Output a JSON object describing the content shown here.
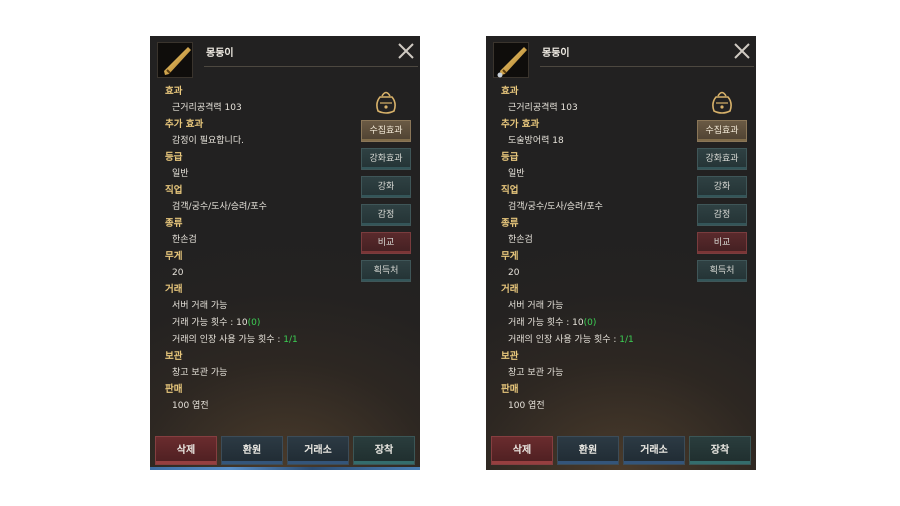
{
  "panels": [
    {
      "item_name": "몽둥이",
      "item_icon": "club-weapon-icon",
      "sections": [
        {
          "header": "효과",
          "rows": [
            {
              "text": "근거리공격력 103"
            }
          ]
        },
        {
          "header": "추가 효과",
          "rows": [
            {
              "text": "감정이 필요합니다."
            }
          ]
        },
        {
          "header": "등급",
          "rows": [
            {
              "text": "일반"
            }
          ]
        },
        {
          "header": "직업",
          "rows": [
            {
              "text": "검객/궁수/도사/승려/포수"
            }
          ]
        },
        {
          "header": "종류",
          "rows": [
            {
              "text": "한손검"
            }
          ]
        },
        {
          "header": "무게",
          "rows": [
            {
              "text": "20"
            }
          ]
        },
        {
          "header": "거래",
          "rows": [
            {
              "text": "서버 거래 가능"
            },
            {
              "text": "거래 가능 횟수 : 10",
              "extra": "(0)"
            },
            {
              "text": "거래의 인장 사용 가능 횟수 : ",
              "extra": "1/1"
            }
          ]
        },
        {
          "header": "보관",
          "rows": [
            {
              "text": "창고 보관 가능"
            }
          ]
        },
        {
          "header": "판매",
          "rows": [
            {
              "text": "100 엽전"
            }
          ]
        }
      ],
      "side_buttons": [
        "수집효과",
        "강화효과",
        "강화",
        "감정",
        "비교",
        "획득처"
      ],
      "bottom_buttons": [
        "삭제",
        "환원",
        "거래소",
        "장착"
      ]
    },
    {
      "item_name": "몽둥이",
      "item_icon": "club-weapon-icon",
      "sections": [
        {
          "header": "효과",
          "rows": [
            {
              "text": "근거리공격력 103"
            }
          ]
        },
        {
          "header": "추가 효과",
          "rows": [
            {
              "text": "도술방어력 18"
            }
          ]
        },
        {
          "header": "등급",
          "rows": [
            {
              "text": "일반"
            }
          ]
        },
        {
          "header": "직업",
          "rows": [
            {
              "text": "검객/궁수/도사/승려/포수"
            }
          ]
        },
        {
          "header": "종류",
          "rows": [
            {
              "text": "한손검"
            }
          ]
        },
        {
          "header": "무게",
          "rows": [
            {
              "text": "20"
            }
          ]
        },
        {
          "header": "거래",
          "rows": [
            {
              "text": "서버 거래 가능"
            },
            {
              "text": "거래 가능 횟수 : 10",
              "extra": "(0)"
            },
            {
              "text": "거래의 인장 사용 가능 횟수 : ",
              "extra": "1/1"
            }
          ]
        },
        {
          "header": "보관",
          "rows": [
            {
              "text": "창고 보관 가능"
            }
          ]
        },
        {
          "header": "판매",
          "rows": [
            {
              "text": "100 엽전"
            }
          ]
        }
      ],
      "side_buttons": [
        "수집효과",
        "강화효과",
        "강화",
        "감정",
        "비교",
        "획득처"
      ],
      "bottom_buttons": [
        "삭제",
        "환원",
        "거래소",
        "장착"
      ]
    }
  ],
  "colors": {
    "header_gold": "#e8c77c",
    "value_green": "#3ccf54",
    "panel_bg": "#242221"
  }
}
